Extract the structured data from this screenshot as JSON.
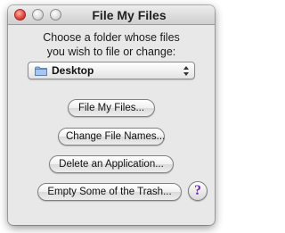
{
  "window": {
    "title": "File My Files"
  },
  "instructions": {
    "line1": "Choose a folder whose files",
    "line2": "you wish to file or change:"
  },
  "folder_popup": {
    "selected": "Desktop",
    "icon": "folder-icon"
  },
  "buttons": {
    "file_my_files": "File My Files...",
    "change_file_names": "Change File Names...",
    "delete_application": "Delete an Application...",
    "empty_trash": "Empty Some of the Trash..."
  },
  "help": {
    "label": "?",
    "icon": "help-icon"
  },
  "colors": {
    "close_button": "#e0443a",
    "help_glyph": "#6a2fb0",
    "window_bg": "#e8e8e8"
  }
}
